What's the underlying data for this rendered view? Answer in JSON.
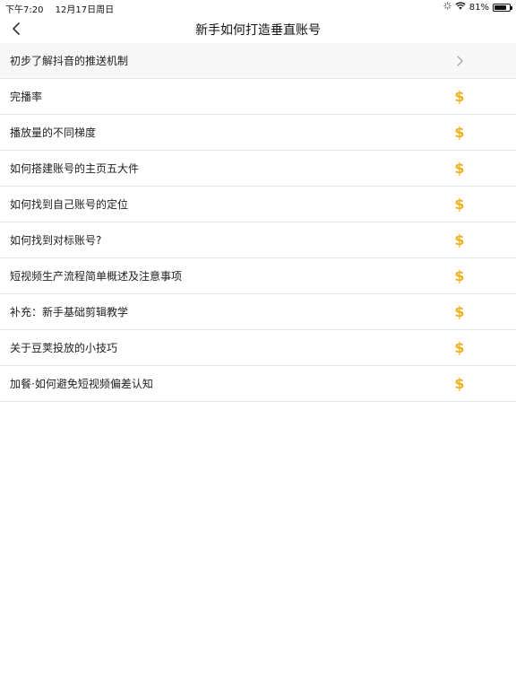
{
  "status_bar": {
    "time": "下午7:20",
    "date": "12月17日周日",
    "battery_percent": "81%",
    "battery_level": 0.81,
    "icons": [
      "loading-icon",
      "wifi-icon",
      "battery-icon"
    ]
  },
  "nav": {
    "title": "新手如何打造垂直账号",
    "back_icon": "chevron-left-icon"
  },
  "items": [
    {
      "label": "初步了解抖音的推送机制",
      "trail": "chevron-right-icon"
    },
    {
      "label": "完播率",
      "trail": "dollar-icon"
    },
    {
      "label": "播放量的不同梯度",
      "trail": "dollar-icon"
    },
    {
      "label": "如何搭建账号的主页五大件",
      "trail": "dollar-icon"
    },
    {
      "label": "如何找到自己账号的定位",
      "trail": "dollar-icon"
    },
    {
      "label": "如何找到对标账号?",
      "trail": "dollar-icon"
    },
    {
      "label": "短视频生产流程简单概述及注意事项",
      "trail": "dollar-icon"
    },
    {
      "label": "补充：新手基础剪辑教学",
      "trail": "dollar-icon"
    },
    {
      "label": "关于豆荚投放的小技巧",
      "trail": "dollar-icon"
    },
    {
      "label": "加餐·如何避免短视频偏差认知",
      "trail": "dollar-icon"
    }
  ],
  "colors": {
    "accent": "#f0b11f",
    "divider": "#e6e6e6",
    "first_row_bg": "#f7f7f7"
  }
}
